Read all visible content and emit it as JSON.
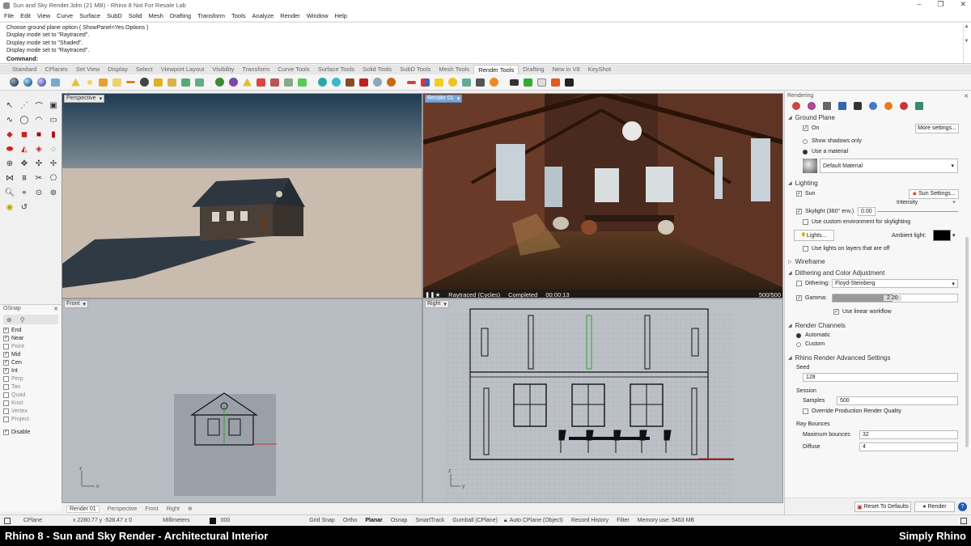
{
  "window": {
    "title": "Sun and Sky Render.3dm (21 MB) - Rhino 8 Not For Resale Lab"
  },
  "menu": [
    "File",
    "Edit",
    "View",
    "Curve",
    "Surface",
    "SubD",
    "Solid",
    "Mesh",
    "Drafting",
    "Transform",
    "Tools",
    "Analyze",
    "Render",
    "Window",
    "Help"
  ],
  "command": {
    "history": [
      "Choose ground plane option ( ShowPanel=Yes  Options )",
      "Display mode set to \"Raytraced\".",
      "Display mode set to \"Shaded\".",
      "Display mode set to \"Raytraced\"."
    ],
    "prompt": "Command:"
  },
  "toolbar_tabs": [
    "Standard",
    "CPlanes",
    "Set View",
    "Display",
    "Select",
    "Viewport Layout",
    "Visibility",
    "Transform",
    "Curve Tools",
    "Surface Tools",
    "Solid Tools",
    "SubD Tools",
    "Mesh Tools",
    "Render Tools",
    "Drafting",
    "New in V8",
    "KeyShot"
  ],
  "active_tab": "Render Tools",
  "viewports": {
    "perspective": {
      "label": "Perspective"
    },
    "render": {
      "label": "Render 01",
      "status_engine": "Raytraced (Cycles)",
      "status_state": "Completed",
      "status_time": "00:00:13",
      "status_samples": "500/500"
    },
    "front": {
      "label": "Front"
    },
    "right": {
      "label": "Right"
    }
  },
  "viewport_tabs": [
    "Render 01",
    "Perspective",
    "Front",
    "Right"
  ],
  "osnap": {
    "title": "OSnap",
    "items": [
      {
        "label": "End",
        "checked": true
      },
      {
        "label": "Near",
        "checked": true
      },
      {
        "label": "Point",
        "checked": false
      },
      {
        "label": "Mid",
        "checked": true
      },
      {
        "label": "Cen",
        "checked": true
      },
      {
        "label": "Int",
        "checked": true
      },
      {
        "label": "Perp",
        "checked": false
      },
      {
        "label": "Tan",
        "checked": false
      },
      {
        "label": "Quad",
        "checked": false
      },
      {
        "label": "Knot",
        "checked": false
      },
      {
        "label": "Vertex",
        "checked": false
      },
      {
        "label": "Project",
        "checked": false
      }
    ],
    "disable": "Disable"
  },
  "rendering": {
    "title": "Rendering",
    "ground_plane": {
      "header": "Ground Plane",
      "on": "On",
      "more": "More settings...",
      "shadows_only": "Show shadows only",
      "use_material": "Use a material",
      "material": "Default Material"
    },
    "lighting": {
      "header": "Lighting",
      "sun": "Sun",
      "sun_settings": "Sun Settings...",
      "intensity": "Intensity",
      "skylight": "Skylight (360° env.)",
      "skylight_value": "0.00",
      "custom_env": "Use custom environment for skylighting",
      "lights": "Lights...",
      "ambient": "Ambient light:",
      "lights_on_layers": "Use lights on layers that are off"
    },
    "wireframe": "Wireframe",
    "dither": {
      "header": "Dithering and Color Adjustment",
      "dithering": "Dithering:",
      "dither_value": "Floyd-Steinberg",
      "gamma": "Gamma:",
      "gamma_value": "2.20",
      "linear": "Use linear workflow"
    },
    "channels": {
      "header": "Render Channels",
      "automatic": "Automatic",
      "custom": "Custom"
    },
    "advanced": {
      "header": "Rhino Render Advanced Settings",
      "seed": "Seed",
      "seed_value": "128",
      "session": "Session",
      "samples": "Samples",
      "samples_value": "500",
      "override": "Override Production Render Quality",
      "ray_bounces": "Ray Bounces",
      "max_bounces": "Maximum bounces",
      "max_bounces_value": "32",
      "diffuse": "Diffuse",
      "diffuse_value": "4"
    },
    "reset": "Reset To Defaults",
    "render": "Render"
  },
  "status": {
    "cplane": "CPlane",
    "coords": "x 2280.77  y -528.47  z 0",
    "units": "Millimeters",
    "layer": "000",
    "toggles": [
      "Grid Snap",
      "Ortho",
      "Planar",
      "Osnap",
      "SmartTrack",
      "Gumball (CPlane)",
      "Auto CPlane (Object)",
      "Record History",
      "Filter"
    ],
    "active_toggle": "Planar",
    "memory": "Memory use: 5463 MB"
  },
  "caption": {
    "left": "Rhino 8 - Sun and Sky Render - Architectural Interior",
    "right": "Simply Rhino"
  },
  "colors": {
    "accent_blue": "#7aa5d6",
    "sky_top": "#1f3b52",
    "ground": "#c9bcae",
    "viewport_gray": "#b9bec4"
  }
}
